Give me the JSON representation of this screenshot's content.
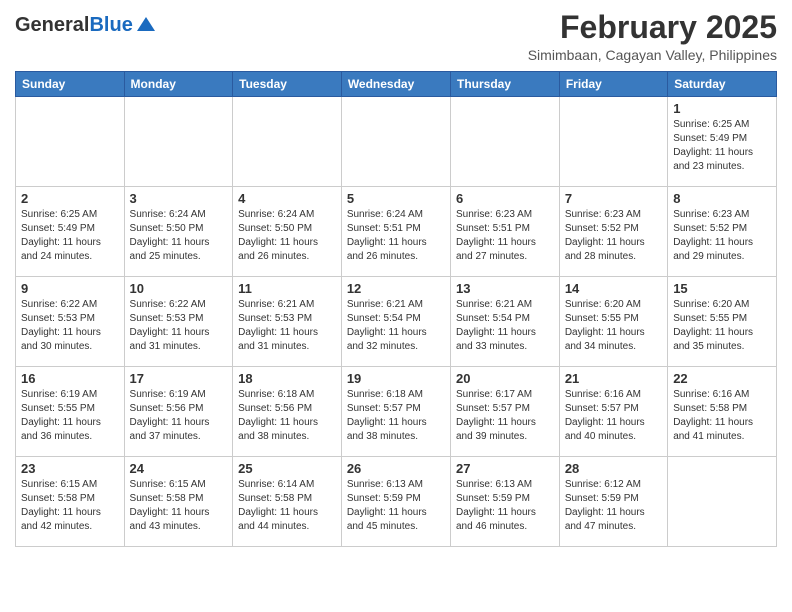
{
  "header": {
    "logo_general": "General",
    "logo_blue": "Blue",
    "main_title": "February 2025",
    "subtitle": "Simimbaan, Cagayan Valley, Philippines"
  },
  "days_of_week": [
    "Sunday",
    "Monday",
    "Tuesday",
    "Wednesday",
    "Thursday",
    "Friday",
    "Saturday"
  ],
  "weeks": [
    {
      "cells": [
        {
          "day": "",
          "sunrise": "",
          "sunset": "",
          "daylight": ""
        },
        {
          "day": "",
          "sunrise": "",
          "sunset": "",
          "daylight": ""
        },
        {
          "day": "",
          "sunrise": "",
          "sunset": "",
          "daylight": ""
        },
        {
          "day": "",
          "sunrise": "",
          "sunset": "",
          "daylight": ""
        },
        {
          "day": "",
          "sunrise": "",
          "sunset": "",
          "daylight": ""
        },
        {
          "day": "",
          "sunrise": "",
          "sunset": "",
          "daylight": ""
        },
        {
          "day": "1",
          "sunrise": "Sunrise: 6:25 AM",
          "sunset": "Sunset: 5:49 PM",
          "daylight": "Daylight: 11 hours and 23 minutes."
        }
      ]
    },
    {
      "cells": [
        {
          "day": "2",
          "sunrise": "Sunrise: 6:25 AM",
          "sunset": "Sunset: 5:49 PM",
          "daylight": "Daylight: 11 hours and 24 minutes."
        },
        {
          "day": "3",
          "sunrise": "Sunrise: 6:24 AM",
          "sunset": "Sunset: 5:50 PM",
          "daylight": "Daylight: 11 hours and 25 minutes."
        },
        {
          "day": "4",
          "sunrise": "Sunrise: 6:24 AM",
          "sunset": "Sunset: 5:50 PM",
          "daylight": "Daylight: 11 hours and 26 minutes."
        },
        {
          "day": "5",
          "sunrise": "Sunrise: 6:24 AM",
          "sunset": "Sunset: 5:51 PM",
          "daylight": "Daylight: 11 hours and 26 minutes."
        },
        {
          "day": "6",
          "sunrise": "Sunrise: 6:23 AM",
          "sunset": "Sunset: 5:51 PM",
          "daylight": "Daylight: 11 hours and 27 minutes."
        },
        {
          "day": "7",
          "sunrise": "Sunrise: 6:23 AM",
          "sunset": "Sunset: 5:52 PM",
          "daylight": "Daylight: 11 hours and 28 minutes."
        },
        {
          "day": "8",
          "sunrise": "Sunrise: 6:23 AM",
          "sunset": "Sunset: 5:52 PM",
          "daylight": "Daylight: 11 hours and 29 minutes."
        }
      ]
    },
    {
      "cells": [
        {
          "day": "9",
          "sunrise": "Sunrise: 6:22 AM",
          "sunset": "Sunset: 5:53 PM",
          "daylight": "Daylight: 11 hours and 30 minutes."
        },
        {
          "day": "10",
          "sunrise": "Sunrise: 6:22 AM",
          "sunset": "Sunset: 5:53 PM",
          "daylight": "Daylight: 11 hours and 31 minutes."
        },
        {
          "day": "11",
          "sunrise": "Sunrise: 6:21 AM",
          "sunset": "Sunset: 5:53 PM",
          "daylight": "Daylight: 11 hours and 31 minutes."
        },
        {
          "day": "12",
          "sunrise": "Sunrise: 6:21 AM",
          "sunset": "Sunset: 5:54 PM",
          "daylight": "Daylight: 11 hours and 32 minutes."
        },
        {
          "day": "13",
          "sunrise": "Sunrise: 6:21 AM",
          "sunset": "Sunset: 5:54 PM",
          "daylight": "Daylight: 11 hours and 33 minutes."
        },
        {
          "day": "14",
          "sunrise": "Sunrise: 6:20 AM",
          "sunset": "Sunset: 5:55 PM",
          "daylight": "Daylight: 11 hours and 34 minutes."
        },
        {
          "day": "15",
          "sunrise": "Sunrise: 6:20 AM",
          "sunset": "Sunset: 5:55 PM",
          "daylight": "Daylight: 11 hours and 35 minutes."
        }
      ]
    },
    {
      "cells": [
        {
          "day": "16",
          "sunrise": "Sunrise: 6:19 AM",
          "sunset": "Sunset: 5:55 PM",
          "daylight": "Daylight: 11 hours and 36 minutes."
        },
        {
          "day": "17",
          "sunrise": "Sunrise: 6:19 AM",
          "sunset": "Sunset: 5:56 PM",
          "daylight": "Daylight: 11 hours and 37 minutes."
        },
        {
          "day": "18",
          "sunrise": "Sunrise: 6:18 AM",
          "sunset": "Sunset: 5:56 PM",
          "daylight": "Daylight: 11 hours and 38 minutes."
        },
        {
          "day": "19",
          "sunrise": "Sunrise: 6:18 AM",
          "sunset": "Sunset: 5:57 PM",
          "daylight": "Daylight: 11 hours and 38 minutes."
        },
        {
          "day": "20",
          "sunrise": "Sunrise: 6:17 AM",
          "sunset": "Sunset: 5:57 PM",
          "daylight": "Daylight: 11 hours and 39 minutes."
        },
        {
          "day": "21",
          "sunrise": "Sunrise: 6:16 AM",
          "sunset": "Sunset: 5:57 PM",
          "daylight": "Daylight: 11 hours and 40 minutes."
        },
        {
          "day": "22",
          "sunrise": "Sunrise: 6:16 AM",
          "sunset": "Sunset: 5:58 PM",
          "daylight": "Daylight: 11 hours and 41 minutes."
        }
      ]
    },
    {
      "cells": [
        {
          "day": "23",
          "sunrise": "Sunrise: 6:15 AM",
          "sunset": "Sunset: 5:58 PM",
          "daylight": "Daylight: 11 hours and 42 minutes."
        },
        {
          "day": "24",
          "sunrise": "Sunrise: 6:15 AM",
          "sunset": "Sunset: 5:58 PM",
          "daylight": "Daylight: 11 hours and 43 minutes."
        },
        {
          "day": "25",
          "sunrise": "Sunrise: 6:14 AM",
          "sunset": "Sunset: 5:58 PM",
          "daylight": "Daylight: 11 hours and 44 minutes."
        },
        {
          "day": "26",
          "sunrise": "Sunrise: 6:13 AM",
          "sunset": "Sunset: 5:59 PM",
          "daylight": "Daylight: 11 hours and 45 minutes."
        },
        {
          "day": "27",
          "sunrise": "Sunrise: 6:13 AM",
          "sunset": "Sunset: 5:59 PM",
          "daylight": "Daylight: 11 hours and 46 minutes."
        },
        {
          "day": "28",
          "sunrise": "Sunrise: 6:12 AM",
          "sunset": "Sunset: 5:59 PM",
          "daylight": "Daylight: 11 hours and 47 minutes."
        },
        {
          "day": "",
          "sunrise": "",
          "sunset": "",
          "daylight": ""
        }
      ]
    }
  ]
}
